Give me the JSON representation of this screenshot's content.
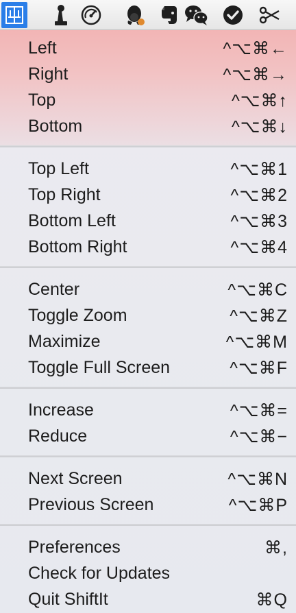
{
  "menubar": {
    "icons": [
      {
        "name": "shiftit-icon",
        "active": true
      },
      {
        "name": "joystick-icon",
        "active": false
      },
      {
        "name": "gauge-icon",
        "active": false
      },
      {
        "name": "penguin-icon",
        "active": false
      },
      {
        "name": "evernote-elephant-icon",
        "active": false
      },
      {
        "name": "wechat-icon",
        "active": false
      },
      {
        "name": "checkmark-icon",
        "active": false
      },
      {
        "name": "scissors-icon",
        "active": false
      }
    ],
    "accent_color": "#2a7ee8"
  },
  "menu": {
    "highlight_color": "#f2b5b5",
    "groups": [
      {
        "items": [
          {
            "label": "Left",
            "shortcut": "^⌥⌘←"
          },
          {
            "label": "Right",
            "shortcut": "^⌥⌘→"
          },
          {
            "label": "Top",
            "shortcut": "^⌥⌘↑"
          },
          {
            "label": "Bottom",
            "shortcut": "^⌥⌘↓"
          }
        ]
      },
      {
        "items": [
          {
            "label": "Top Left",
            "shortcut": "^⌥⌘1"
          },
          {
            "label": "Top Right",
            "shortcut": "^⌥⌘2"
          },
          {
            "label": "Bottom Left",
            "shortcut": "^⌥⌘3"
          },
          {
            "label": "Bottom Right",
            "shortcut": "^⌥⌘4"
          }
        ]
      },
      {
        "items": [
          {
            "label": "Center",
            "shortcut": "^⌥⌘C"
          },
          {
            "label": "Toggle Zoom",
            "shortcut": "^⌥⌘Z"
          },
          {
            "label": "Maximize",
            "shortcut": "^⌥⌘M"
          },
          {
            "label": "Toggle Full Screen",
            "shortcut": "^⌥⌘F"
          }
        ]
      },
      {
        "items": [
          {
            "label": "Increase",
            "shortcut": "^⌥⌘="
          },
          {
            "label": "Reduce",
            "shortcut": "^⌥⌘−"
          }
        ]
      },
      {
        "items": [
          {
            "label": "Next Screen",
            "shortcut": "^⌥⌘N"
          },
          {
            "label": "Previous Screen",
            "shortcut": "^⌥⌘P"
          }
        ]
      },
      {
        "items": [
          {
            "label": "Preferences",
            "shortcut": "⌘,"
          },
          {
            "label": "Check for Updates",
            "shortcut": ""
          },
          {
            "label": "Quit ShiftIt",
            "shortcut": "⌘Q"
          }
        ]
      }
    ]
  }
}
